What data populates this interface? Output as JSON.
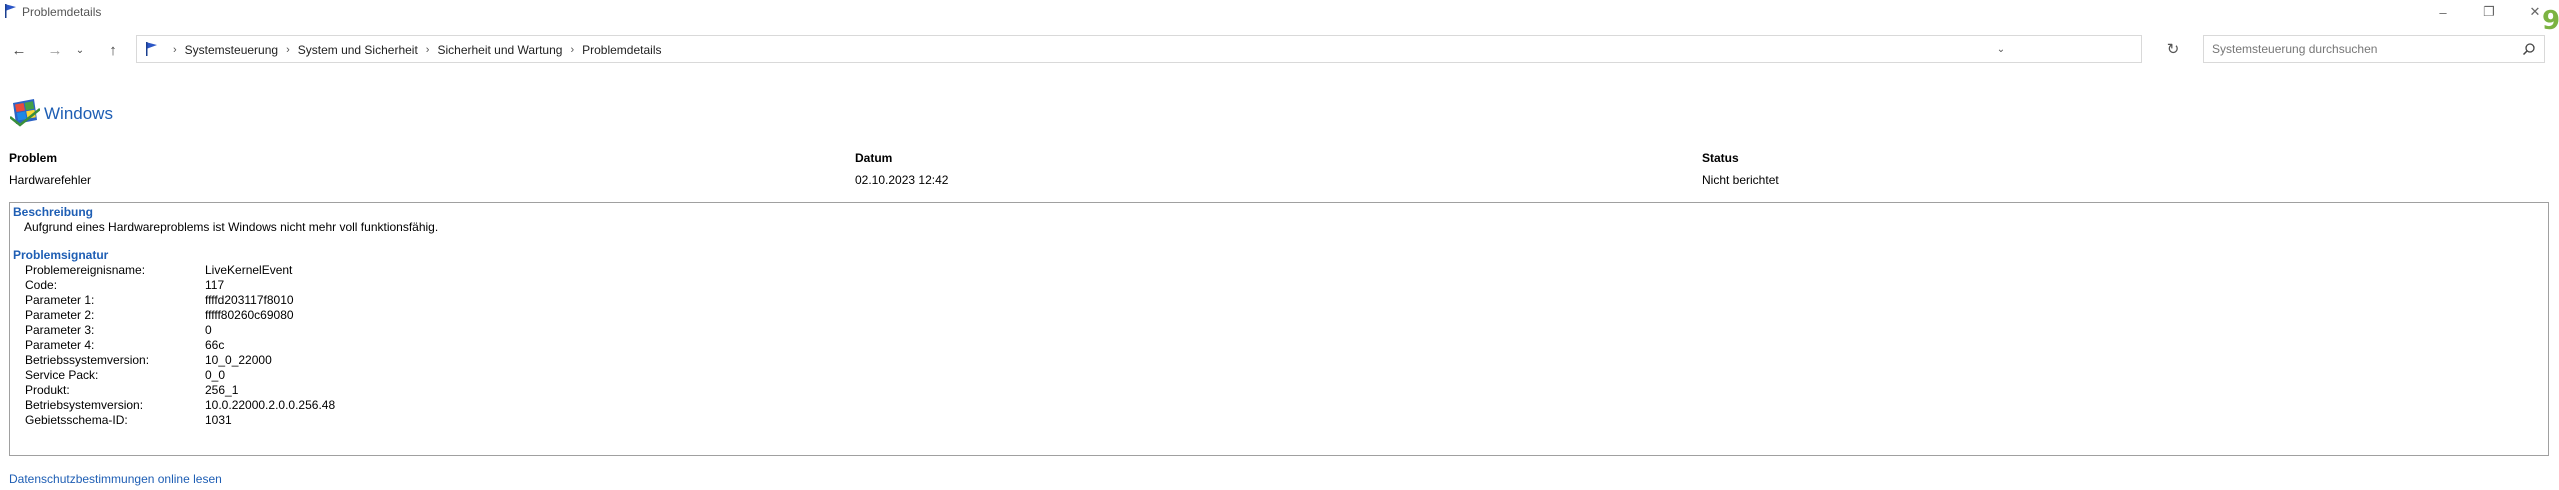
{
  "window": {
    "title": "Problemdetails",
    "corner_badge": "9"
  },
  "address_bar": {
    "breadcrumbs": [
      "Systemsteuerung",
      "System und Sicherheit",
      "Sicherheit und Wartung",
      "Problemdetails"
    ]
  },
  "search": {
    "placeholder": "Systemsteuerung durchsuchen"
  },
  "heading": "Windows",
  "summary": {
    "problem_label": "Problem",
    "date_label": "Datum",
    "status_label": "Status",
    "problem_value": "Hardwarefehler",
    "date_value": "02.10.2023 12:42",
    "status_value": "Nicht berichtet"
  },
  "details": {
    "description_title": "Beschreibung",
    "description_text": "Aufgrund eines Hardwareproblems ist Windows nicht mehr voll funktionsfähig.",
    "signature_title": "Problemsignatur",
    "signature": [
      {
        "key": "Problemereignisname:",
        "value": "LiveKernelEvent"
      },
      {
        "key": "Code:",
        "value": "117"
      },
      {
        "key": "Parameter 1:",
        "value": "ffffd203117f8010"
      },
      {
        "key": "Parameter 2:",
        "value": "fffff80260c69080"
      },
      {
        "key": "Parameter 3:",
        "value": "0"
      },
      {
        "key": "Parameter 4:",
        "value": "66c"
      },
      {
        "key": "Betriebssystemversion:",
        "value": "10_0_22000"
      },
      {
        "key": "Service Pack:",
        "value": "0_0"
      },
      {
        "key": "Produkt:",
        "value": "256_1"
      },
      {
        "key": "Betriebsystemversion:",
        "value": "10.0.22000.2.0.0.256.48"
      },
      {
        "key": "Gebietsschema-ID:",
        "value": "1031"
      }
    ]
  },
  "footer": {
    "privacy_link": "Datenschutzbestimmungen online lesen"
  }
}
